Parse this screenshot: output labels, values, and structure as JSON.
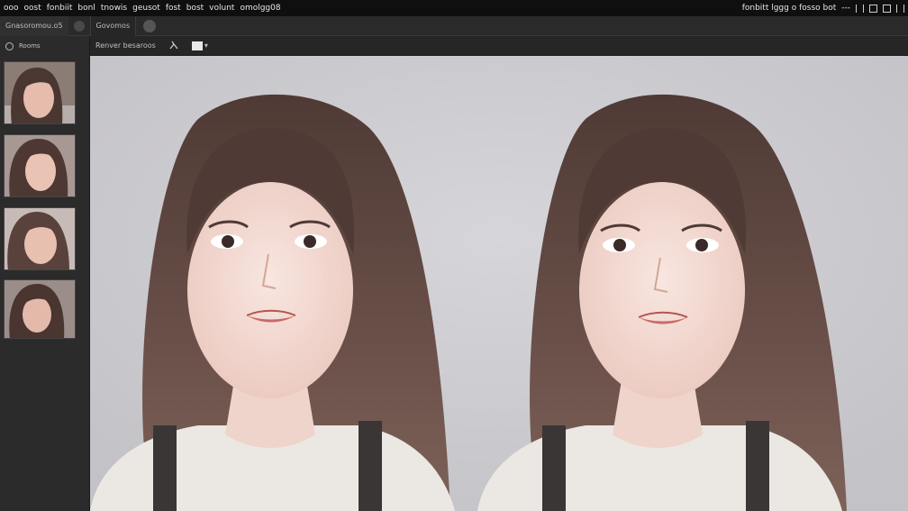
{
  "menubar": {
    "items": [
      "ooo",
      "oost",
      "fonbiit",
      "bonl",
      "tnowis",
      "geusot",
      "fost",
      "bost",
      "volunt",
      "omolgg08"
    ],
    "right_text": "fonbitt lggg o fosso bot",
    "right_extra": "---"
  },
  "tabbar": {
    "workspace": "Gnasoromou.o5",
    "tab": "Govomos"
  },
  "sidebar": {
    "title": "Rooms"
  },
  "toolbar": {
    "label": "Renver besaroos"
  },
  "colors": {
    "menubar_bg": "#0f0f0f",
    "panel_bg": "#2b2b2b",
    "canvas_bg": "#cbcace",
    "hair": "#5b4640",
    "sweater": "#e9e5e0",
    "strap": "#3a3636"
  },
  "icons": [
    "gear-icon",
    "brush-icon",
    "color-swatch-icon",
    "chevron-icon",
    "panel-icon",
    "grid-icon",
    "window-icon",
    "menu-icon"
  ]
}
